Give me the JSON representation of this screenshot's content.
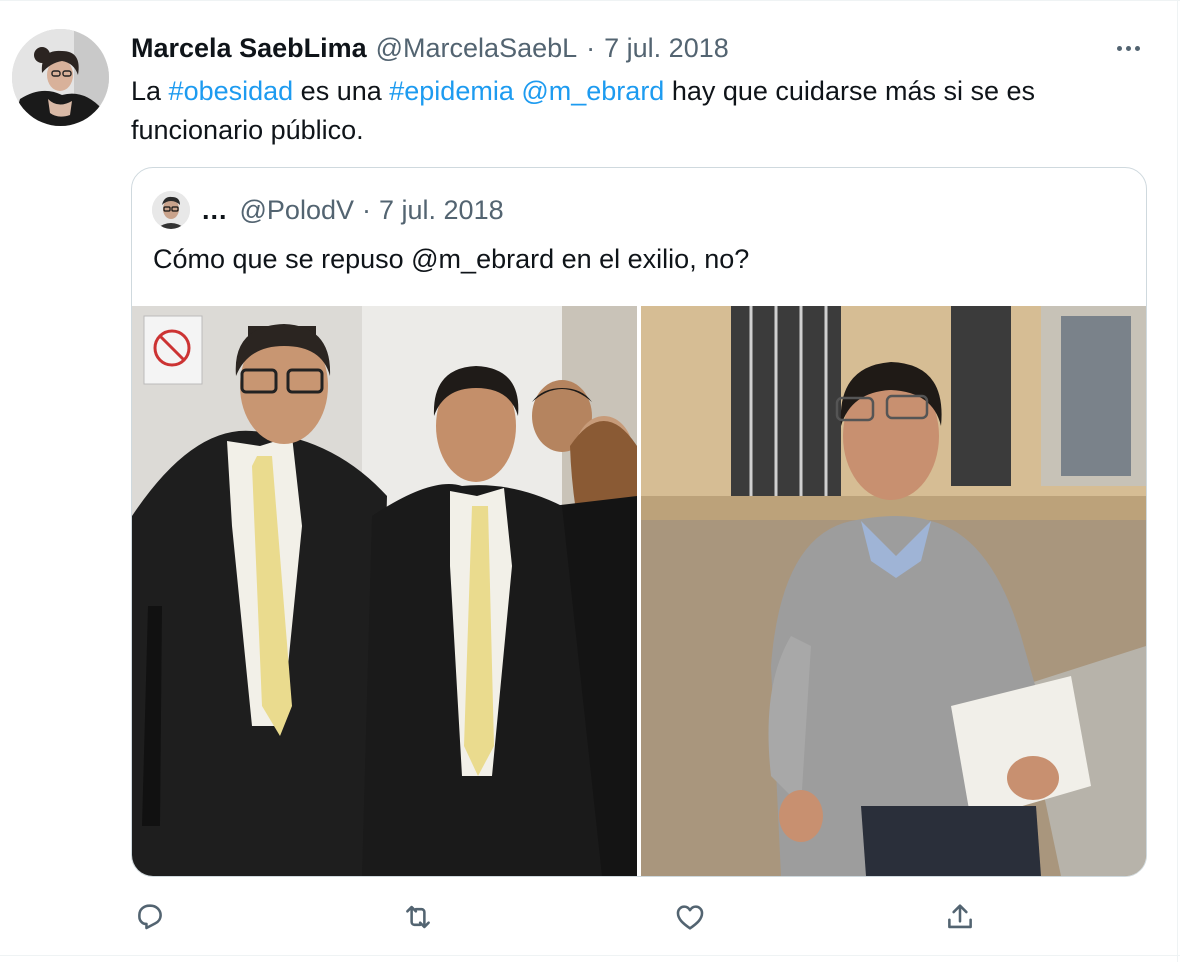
{
  "tweet": {
    "author_name": "Marcela SaebLima",
    "handle": "@MarcelaSaebL",
    "separator": "·",
    "date": "7 jul. 2018",
    "text_parts": {
      "p1": "La ",
      "hashtag1": "#obesidad",
      "p2": " es una ",
      "hashtag2": "#epidemia",
      "p3": " ",
      "mention": "@m_ebrard",
      "p4": " hay que cuidarse más si se es funcionario público."
    }
  },
  "quoted": {
    "name": "...",
    "handle": "@PolodV",
    "separator": "·",
    "date": "7 jul. 2018",
    "text": "Cómo que se repuso @m_ebrard en el exilio, no?"
  },
  "icons": {
    "more": "more-horizontal-icon",
    "reply": "reply-icon",
    "retweet": "retweet-icon",
    "like": "heart-icon",
    "share": "share-icon"
  },
  "colors": {
    "link": "#1d9bf0",
    "text": "#0f1419",
    "secondary": "#536471",
    "border": "#cfd9de"
  }
}
